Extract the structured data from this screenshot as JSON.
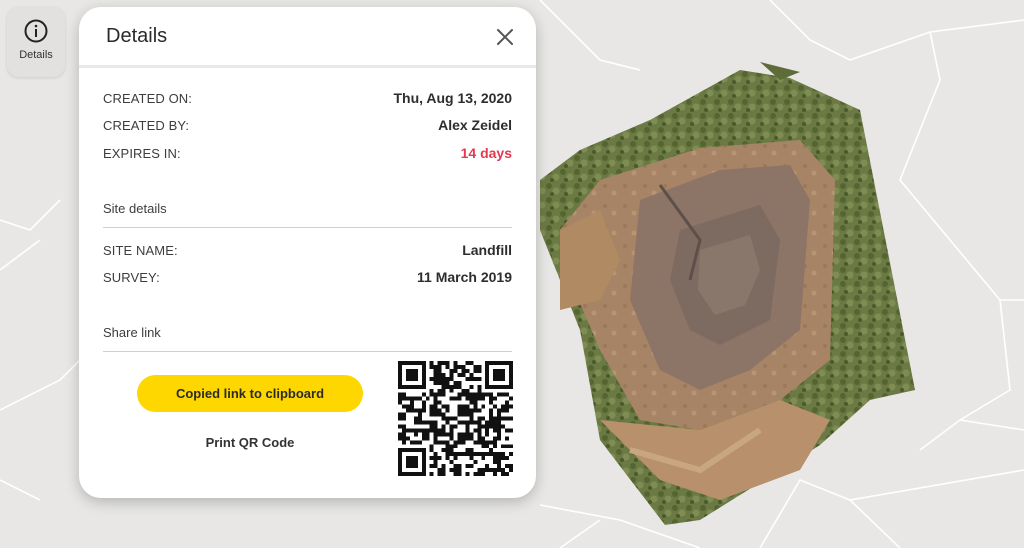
{
  "toolbar": {
    "details_button": {
      "label": "Details",
      "icon": "info-circle-icon"
    }
  },
  "panel": {
    "title": "Details",
    "close_icon": "close-icon",
    "meta": [
      {
        "label": "CREATED ON:",
        "value": "Thu, Aug 13, 2020"
      },
      {
        "label": "CREATED BY:",
        "value": "Alex Zeidel"
      },
      {
        "label": "EXPIRES IN:",
        "value": "14 days",
        "color": "#e4394f"
      }
    ],
    "site_details": {
      "heading": "Site details",
      "rows": [
        {
          "label": "SITE NAME:",
          "value": "Landfill"
        },
        {
          "label": "SURVEY:",
          "value": "11 March 2019"
        }
      ]
    },
    "share": {
      "heading": "Share link",
      "copy_button": "Copied link to clipboard",
      "print_link": "Print QR Code",
      "qr_icon": "qr-code-icon"
    }
  },
  "map": {
    "background": "#e8e7e5",
    "road_color": "#ffffff",
    "imagery": "aerial-landfill-survey-image"
  },
  "colors": {
    "accent": "#fed600",
    "warning": "#e4394f"
  }
}
